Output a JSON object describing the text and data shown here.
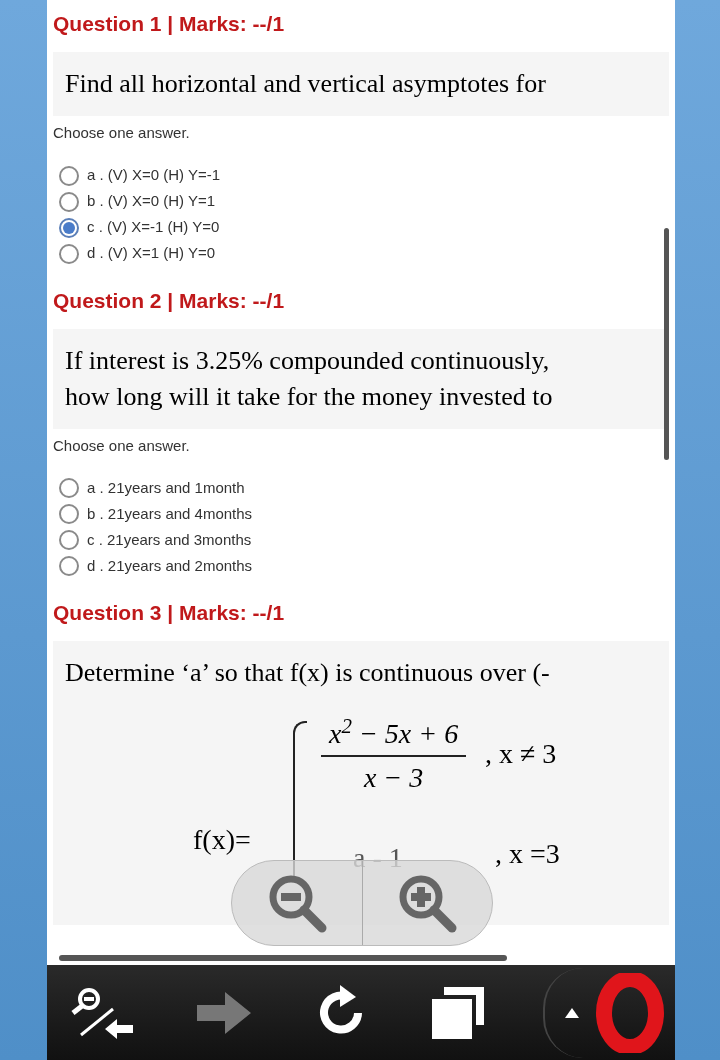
{
  "questions": [
    {
      "header": "Question 1 | Marks: --/1",
      "text": [
        "Find all horizontal and vertical asymptotes for"
      ],
      "prompt": "Choose one answer.",
      "options": [
        {
          "label": "a . (V) X=0 (H) Y=-1",
          "selected": false
        },
        {
          "label": "b . (V) X=0 (H) Y=1",
          "selected": false
        },
        {
          "label": "c . (V) X=-1 (H) Y=0",
          "selected": true
        },
        {
          "label": "d . (V) X=1 (H) Y=0",
          "selected": false
        }
      ]
    },
    {
      "header": "Question 2 | Marks: --/1",
      "text": [
        "If  interest is 3.25% compounded continuously,",
        "how long will it take for the money invested to"
      ],
      "prompt": "Choose one answer.",
      "options": [
        {
          "label": "a . 21years and 1month",
          "selected": false
        },
        {
          "label": "b . 21years and 4months",
          "selected": false
        },
        {
          "label": "c . 21years and 3months",
          "selected": false
        },
        {
          "label": "d . 21years and 2months",
          "selected": false
        }
      ]
    },
    {
      "header": "Question 3 | Marks: --/1",
      "text": [
        "Determine ‘a’ so that f(x) is continuous over (-"
      ],
      "formula": {
        "lhs": "f(x)=",
        "numerator": "x$^{2}$ − 5x + 6",
        "denominator": "x − 3",
        "case_1": ", x ≠ 3",
        "value_2": "a - 1",
        "case_2": ", x =3"
      }
    }
  ],
  "toolbar": [
    {
      "kind": "zoom-back",
      "disabled": false
    },
    {
      "kind": "forward",
      "disabled": true
    },
    {
      "kind": "reload",
      "disabled": false
    },
    {
      "kind": "tabs",
      "disabled": false
    },
    {
      "kind": "menu",
      "disabled": false
    }
  ]
}
